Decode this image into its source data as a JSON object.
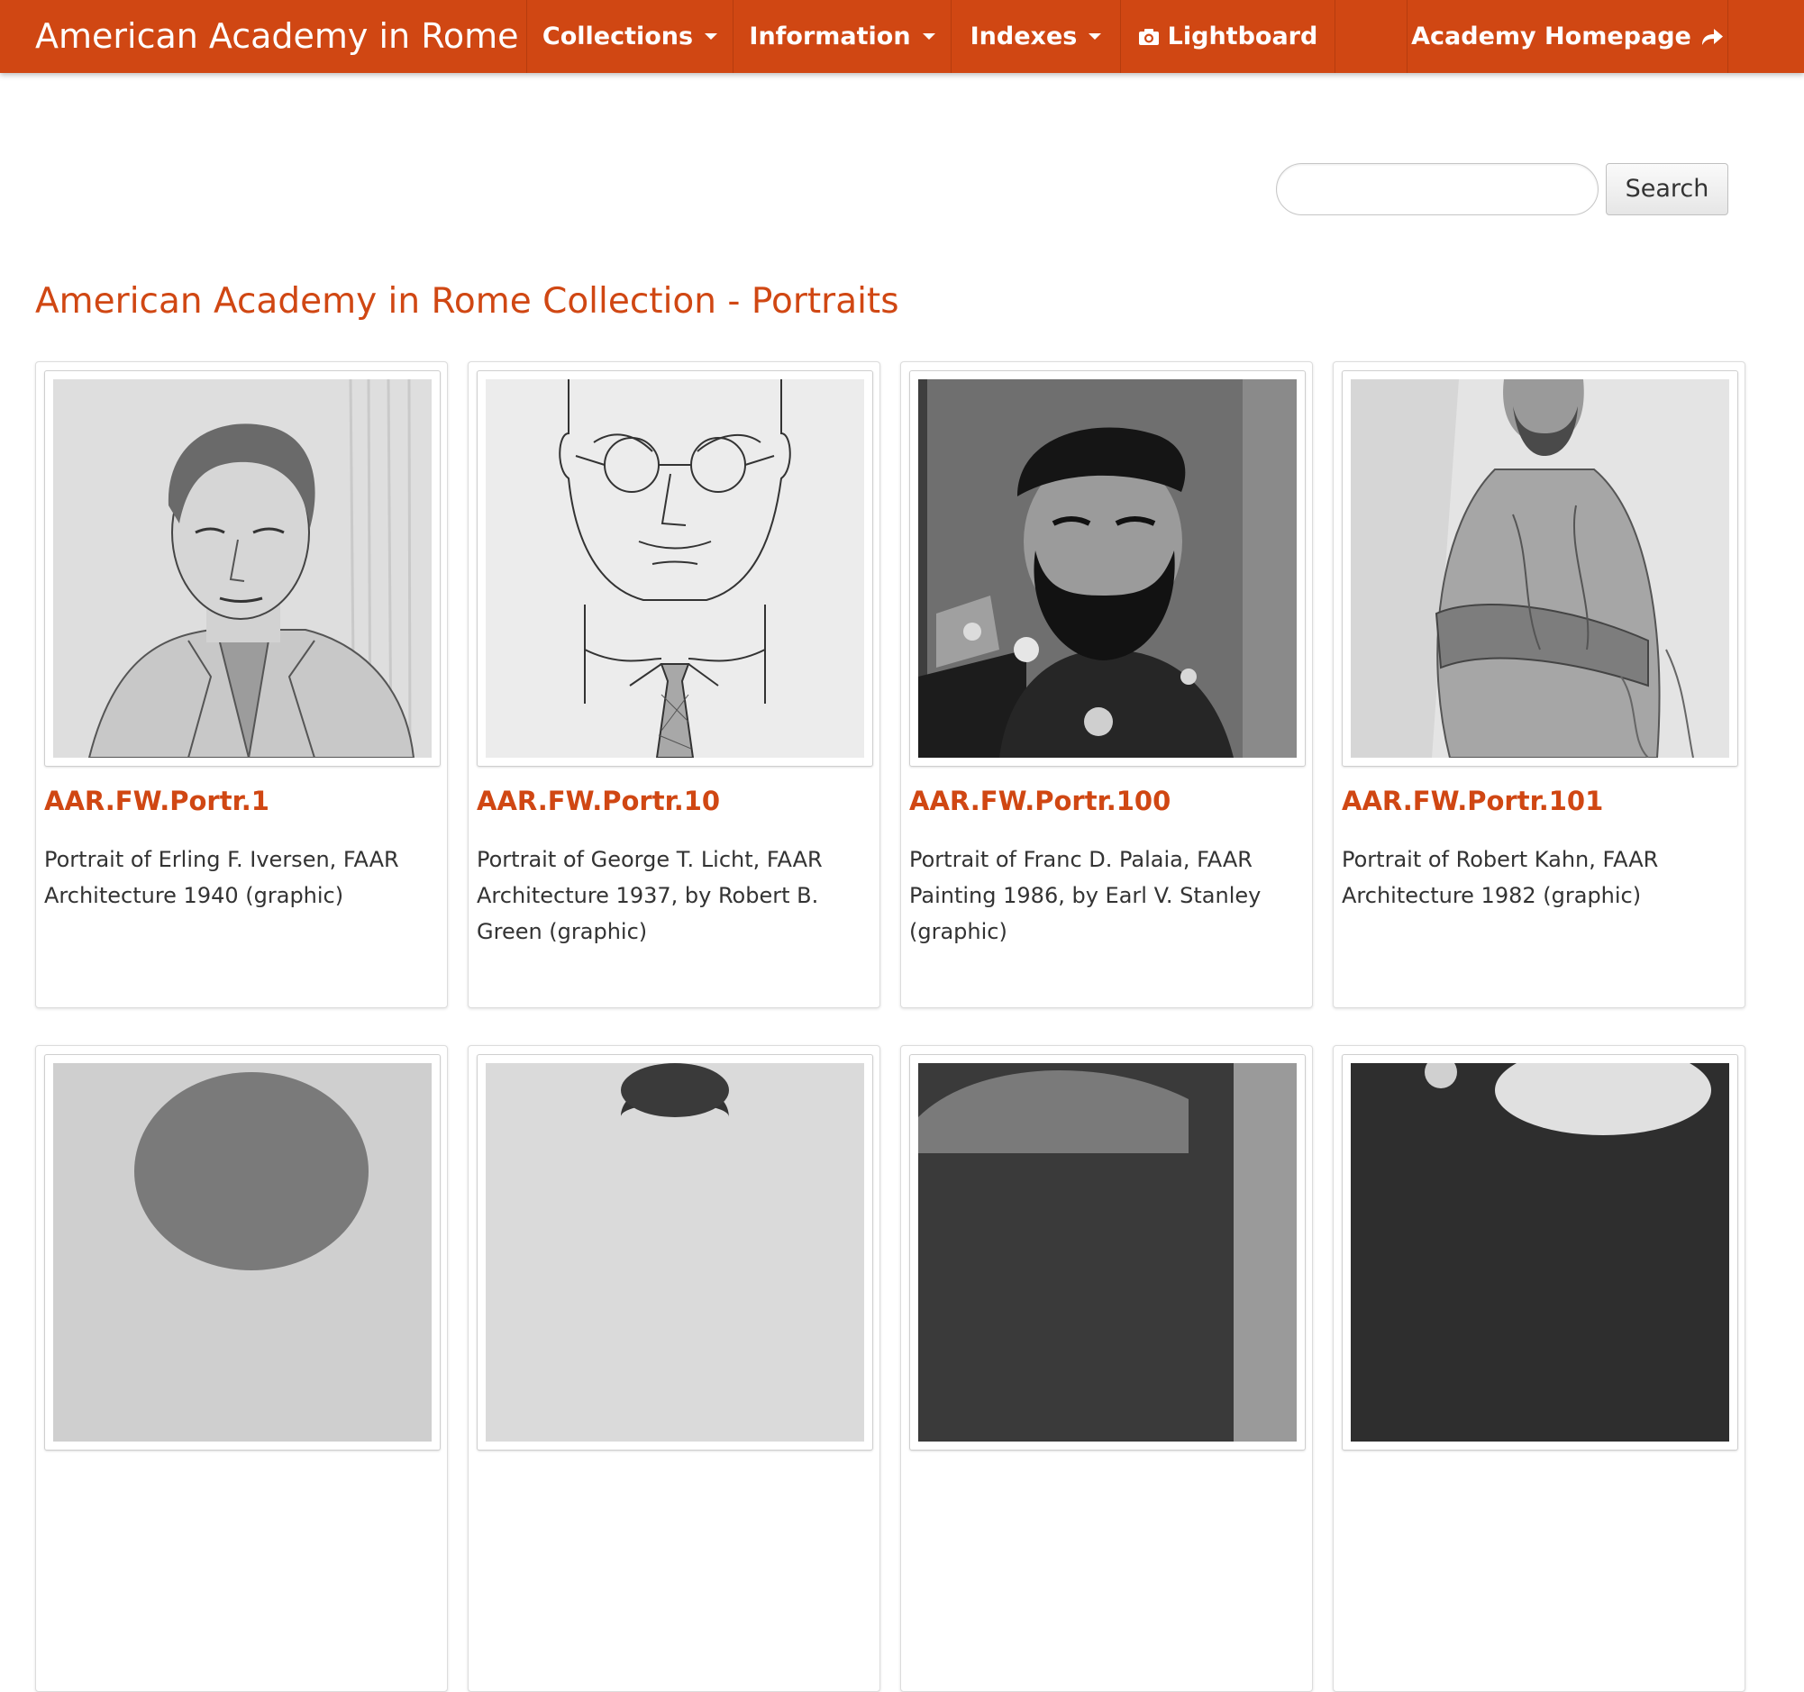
{
  "navbar": {
    "brand": "American Academy in Rome",
    "items": [
      {
        "label": "Collections",
        "icon": "caret-down-icon"
      },
      {
        "label": "Information",
        "icon": "caret-down-icon"
      },
      {
        "label": "Indexes",
        "icon": "caret-down-icon"
      },
      {
        "label": "Lightboard",
        "icon": "camera-icon"
      },
      {
        "label": "Academy Homepage",
        "icon": "share-arrow-icon"
      }
    ]
  },
  "search": {
    "placeholder": "",
    "value": "",
    "button_label": "Search"
  },
  "page": {
    "title": "American Academy in Rome Collection - Portraits"
  },
  "colors": {
    "accent": "#d04713",
    "text": "#333333",
    "border": "#dcdcdc"
  },
  "cards": [
    {
      "id": "AAR.FW.Portr.1",
      "description": "Portrait of Erling F. Iversen, FAAR Architecture 1940 (graphic)"
    },
    {
      "id": "AAR.FW.Portr.10",
      "description": "Portrait of George T. Licht, FAAR Architecture 1937, by Robert B. Green (graphic)"
    },
    {
      "id": "AAR.FW.Portr.100",
      "description": "Portrait of Franc D. Palaia, FAAR Painting 1986, by Earl V. Stanley (graphic)"
    },
    {
      "id": "AAR.FW.Portr.101",
      "description": "Portrait of Robert Kahn, FAAR Architecture 1982 (graphic)"
    }
  ]
}
